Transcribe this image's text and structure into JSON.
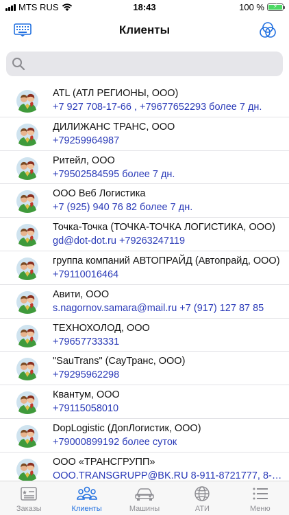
{
  "status_bar": {
    "carrier": "MTS RUS",
    "time": "18:43",
    "battery": "100 %",
    "battery_level": 1.0
  },
  "nav": {
    "title": "Клиенты",
    "left_icon": "keyboard-icon",
    "right_icon": "color-filter-icon"
  },
  "search": {
    "placeholder": ""
  },
  "clients": [
    {
      "name": "ATL (АТЛ РЕГИОНЫ, ООО)",
      "contact": "+7 927 708-17-66 , +79677652293 более 7 дн."
    },
    {
      "name": "ДИЛИЖАНС ТРАНС, ООО",
      "contact": "+79259964987"
    },
    {
      "name": "Ритейл, ООО",
      "contact": "+79502584595 более 7 дн."
    },
    {
      "name": "ООО Веб Логистика",
      "contact": "+7 (925) 940 76 82 более 7 дн."
    },
    {
      "name": "Точка-Точка (ТОЧКА-ТОЧКА ЛОГИСТИКА, ООО)",
      "contact": "gd@dot-dot.ru +79263247119"
    },
    {
      "name": "группа компаний АВТОПРАЙД (Автопрайд, ООО)",
      "contact": "+79110016464"
    },
    {
      "name": "Авити, ООО",
      "contact": "s.nagornov.samara@mail.ru +7 (917) 127 87 85"
    },
    {
      "name": "ТЕХНОХОЛОД, ООО",
      "contact": "+79657733331"
    },
    {
      "name": "\"SauTrans\" (СауТранс, ООО)",
      "contact": "+79295962298"
    },
    {
      "name": "Квантум, ООО",
      "contact": "+79115058010"
    },
    {
      "name": "DopLogistic (ДопЛогистик, ООО)",
      "contact": "+79000899192 более суток"
    },
    {
      "name": "ООО «ТРАНСГРУПП»",
      "contact": "OOO.TRANSGRUPP@BK.RU 8-911-8721777, 8-95..."
    }
  ],
  "tabs": [
    {
      "label": "Заказы",
      "icon": "orders-list-icon",
      "active": false
    },
    {
      "label": "Клиенты",
      "icon": "clients-group-icon",
      "active": true
    },
    {
      "label": "Машины",
      "icon": "car-icon",
      "active": false
    },
    {
      "label": "АТИ",
      "icon": "globe-icon",
      "active": false
    },
    {
      "label": "Меню",
      "icon": "menu-icon",
      "active": false
    }
  ],
  "colors": {
    "accent": "#1f6fe0",
    "link": "#2a3ab8",
    "inactive": "#8e8e93"
  }
}
